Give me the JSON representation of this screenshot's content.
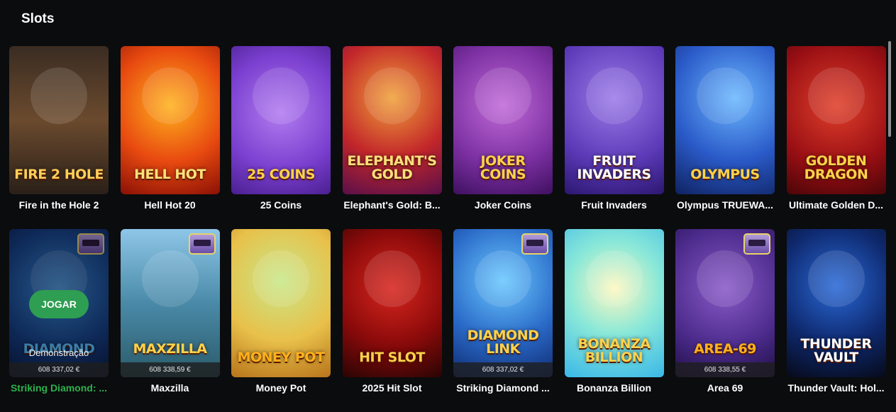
{
  "section": {
    "title": "Slots"
  },
  "games": [
    {
      "name": "Fire in the Hole 2",
      "art": "FIRE 2 HOLE",
      "bg": "linear-gradient(#3a2c22,#6b4a2e 50%,#2a2018)",
      "artColor": "#ffcf5a"
    },
    {
      "name": "Hell Hot 20",
      "art": "HELL HOT",
      "bg": "radial-gradient(circle at 50% 40%,#ffb21e,#e84a10 55%,#8a1005)",
      "artColor": "#ffe27a"
    },
    {
      "name": "25 Coins",
      "art": "25 COINS",
      "bg": "radial-gradient(circle at 50% 45%,#b27cf0,#7a3fcf 60%,#4a1f8f)",
      "artColor": "#ffd24a"
    },
    {
      "name": "Elephant's Gold: B...",
      "art": "ELEPHANT'S GOLD",
      "bg": "radial-gradient(circle at 50% 35%,#f0a13a,#c2262a 55%,#5a0f4a)",
      "artColor": "#ffe07a"
    },
    {
      "name": "Joker Coins",
      "art": "JOKER COINS",
      "bg": "radial-gradient(circle at 50% 40%,#c16ad8,#7a2fa0 60%,#3f1060)",
      "artColor": "#ffd24a"
    },
    {
      "name": "Fruit Invaders",
      "art": "FRUIT INVADERS",
      "bg": "radial-gradient(circle at 50% 35%,#9c7be8,#5c3ab8 60%,#2b1770)",
      "artColor": "#ffffff"
    },
    {
      "name": "Olympus TRUEWA...",
      "art": "OLYMPUS",
      "bg": "radial-gradient(circle at 60% 35%,#6cb8ff,#2a5ac8 55%,#0f2260)",
      "artColor": "#ffd24a"
    },
    {
      "name": "Ultimate Golden D...",
      "art": "GOLDEN DRAGON",
      "bg": "radial-gradient(circle at 50% 40%,#e0402a,#9a0f14 60%,#4a0508)",
      "artColor": "#ffd24a"
    },
    {
      "name": "Striking Diamond: ...",
      "art": "DIAMOND",
      "bg": "radial-gradient(circle at 50% 40%,#3a8ad8,#163f86 60%,#0a1a44)",
      "artColor": "#5ac0ff",
      "jackpot": "608 337,02 €",
      "hovered": true,
      "playLabel": "JOGAR",
      "demoLabel": "Demonstração",
      "badge": true
    },
    {
      "name": "Maxzilla",
      "art": "MAXZILLA",
      "bg": "linear-gradient(#8ec6e8,#4a8aa8 50%,#2a5a6a)",
      "artColor": "#ffd24a",
      "jackpot": "608 338,59 €",
      "badge": true
    },
    {
      "name": "Money Pot",
      "art": "MONEY POT",
      "bg": "radial-gradient(circle at 50% 35%,#c8e88a,#e8c04a 55%,#b8741a)",
      "artColor": "#ffb01a"
    },
    {
      "name": "2025 Hit Slot",
      "art": "HIT SLOT",
      "bg": "radial-gradient(circle at 50% 40%,#d8261e,#8a0a0a 55%,#2a0404)",
      "artColor": "#ffd24a"
    },
    {
      "name": "Striking Diamond ...",
      "art": "DIAMOND LINK",
      "bg": "radial-gradient(circle at 50% 35%,#6ac8ff,#2a6ac8 55%,#0f2a70)",
      "artColor": "#ffd24a",
      "jackpot": "608 337,02 €",
      "badge": true
    },
    {
      "name": "Bonanza Billion",
      "art": "BONANZA BILLION",
      "bg": "radial-gradient(circle at 50% 40%,#fff8c0,#8ae8d8 45%,#3ab8e8)",
      "artColor": "#ffd24a"
    },
    {
      "name": "Area 69",
      "art": "AREA-69",
      "bg": "radial-gradient(circle at 50% 40%,#8a5ac8,#4a2a8a 60%,#1f0f44)",
      "artColor": "#ffb01a",
      "jackpot": "608 338,55 €",
      "badge": true
    },
    {
      "name": "Thunder Vault: Hol...",
      "art": "THUNDER VAULT",
      "bg": "radial-gradient(circle at 50% 38%,#2a6ad8,#0f2a70 55%,#060a1a)",
      "artColor": "#ffffff"
    }
  ]
}
